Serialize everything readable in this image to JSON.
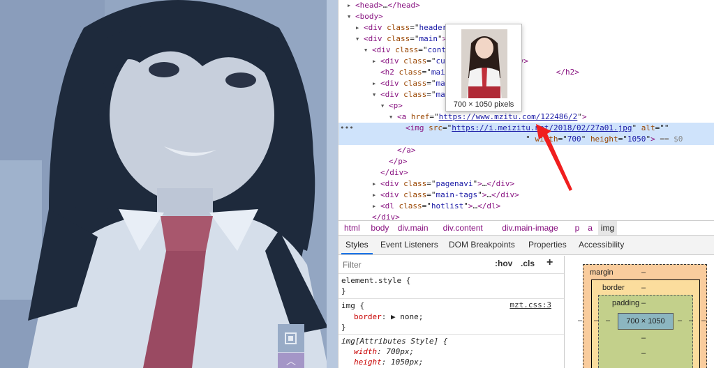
{
  "page_view": {
    "scroll_top_glyph": "︿"
  },
  "dom_tree": {
    "lines": [
      {
        "indent": 1,
        "twisty": "▶",
        "html": "<span class='tag'>&lt;head&gt;</span>…<span class='tag'>&lt;/head&gt;</span>"
      },
      {
        "indent": 1,
        "twisty": "▼",
        "html": "<span class='tag'>&lt;body&gt;</span>"
      },
      {
        "indent": 2,
        "twisty": "▶",
        "html": "<span class='tag'>&lt;div </span><span class='attr'>class</span>=\"<span class='val'>header</span>\"<span class='tag'>&gt;</span>…<span class='tag'>&lt;/div&gt;</span>"
      },
      {
        "indent": 2,
        "twisty": "▼",
        "html": "<span class='tag'>&lt;div </span><span class='attr'>class</span>=\"<span class='val'>main</span>\"<span class='tag'>&gt;</span>"
      },
      {
        "indent": 3,
        "twisty": "▼",
        "html": "<span class='tag'>&lt;div </span><span class='attr'>class</span>=\"<span class='val'>content</span>\"<span class='tag'>&gt;</span>"
      },
      {
        "indent": 4,
        "twisty": "▶",
        "html": "<span class='tag'>&lt;div </span><span class='attr'>class</span>=\"<span class='val'>currentpath</span>\"<span class='tag'>&gt;</span>…<span class='tag'>&lt;/div&gt;</span>"
      },
      {
        "indent": 4,
        "twisty": "",
        "html": "<span class='tag'>&lt;h2 </span><span class='attr'>class</span>=\"<span class='val'>main-title</span>\"<span class='tag'>&gt;</span>               <span class='tag'>&lt;/h2&gt;</span>"
      },
      {
        "indent": 4,
        "twisty": "▶",
        "html": "<span class='tag'>&lt;div </span><span class='attr'>class</span>=\"<span class='val'>main-meta</span>\"<span class='tag'>&gt;</span>…<span class='tag'>&lt;/div&gt;</span>"
      },
      {
        "indent": 4,
        "twisty": "▼",
        "html": "<span class='tag'>&lt;div </span><span class='attr'>class</span>=\"<span class='val'>main-image</span>\"<span class='tag'>&gt;</span>"
      },
      {
        "indent": 5,
        "twisty": "▼",
        "html": "<span class='tag'>&lt;p&gt;</span>"
      },
      {
        "indent": 6,
        "twisty": "▼",
        "html": "<span class='tag'>&lt;a </span><span class='attr'>href</span>=\"<span class='lnk'>https://www.mzitu.com/122486/2</span>\"<span class='tag'>&gt;</span>"
      },
      {
        "indent": 7,
        "twisty": "",
        "sel": true,
        "html": "<span class='tag'>&lt;img </span><span class='attr'>src</span>=\"<span class='lnk'>https://i.meizitu.net/2018/02/27a01.jpg</span>\" <span class='attr'>alt</span>=\"\"<br>                          \" <span class='attr'>width</span>=\"<span class='val'>700</span>\" <span class='attr'>height</span>=\"<span class='val'>1050</span>\"<span class='tag'>&gt;</span> <span class='dim'>== $0</span>"
      },
      {
        "indent": 6,
        "twisty": "",
        "html": "<span class='tag'>&lt;/a&gt;</span>"
      },
      {
        "indent": 5,
        "twisty": "",
        "html": "<span class='tag'>&lt;/p&gt;</span>"
      },
      {
        "indent": 4,
        "twisty": "",
        "html": "<span class='tag'>&lt;/div&gt;</span>"
      },
      {
        "indent": 4,
        "twisty": "▶",
        "html": "<span class='tag'>&lt;div </span><span class='attr'>class</span>=\"<span class='val'>pagenavi</span>\"<span class='tag'>&gt;</span>…<span class='tag'>&lt;/div&gt;</span>"
      },
      {
        "indent": 4,
        "twisty": "▶",
        "html": "<span class='tag'>&lt;div </span><span class='attr'>class</span>=\"<span class='val'>main-tags</span>\"<span class='tag'>&gt;</span>…<span class='tag'>&lt;/div&gt;</span>"
      },
      {
        "indent": 4,
        "twisty": "▶",
        "html": "<span class='tag'>&lt;dl </span><span class='attr'>class</span>=\"<span class='val'>hotlist</span>\"<span class='tag'>&gt;</span>…<span class='tag'>&lt;/dl&gt;</span>"
      },
      {
        "indent": 3,
        "twisty": "",
        "html": "<span class='tag'>&lt;/div&gt;</span>"
      }
    ],
    "selected_ellipsis": "•••"
  },
  "image_preview": {
    "caption": "700 × 1050 pixels"
  },
  "breadcrumb": [
    "html",
    "body",
    "div.main",
    "div.content",
    "div.main-image",
    "p",
    "a",
    "img"
  ],
  "tabs": [
    "Styles",
    "Event Listeners",
    "DOM Breakpoints",
    "Properties",
    "Accessibility"
  ],
  "styles": {
    "filter_placeholder": "Filter",
    "hov": ":hov",
    "cls": ".cls",
    "plus": "+",
    "element_style": "element.style {",
    "close_brace": "}",
    "img_selector": "img {",
    "img_source": "mzt.css:3",
    "border_prop": "border",
    "border_val": "▶ none;",
    "attr_selector": "img[Attributes Style] {",
    "width_prop": "width",
    "width_val": "700px;",
    "height_prop": "height",
    "height_val": "1050px;"
  },
  "box_model": {
    "margin_label": "margin",
    "border_label": "border",
    "padding_label": "padding",
    "content_size": "700 × 1050",
    "dash": "–"
  }
}
